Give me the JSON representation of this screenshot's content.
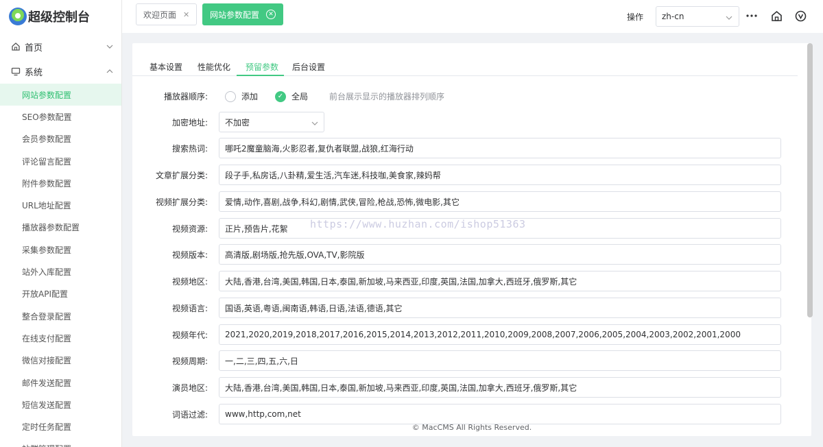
{
  "app": {
    "title": "超级控制台"
  },
  "sidebar": {
    "home": {
      "label": "首页"
    },
    "system": {
      "label": "系统"
    },
    "items": [
      {
        "label": "网站参数配置",
        "active": true
      },
      {
        "label": "SEO参数配置"
      },
      {
        "label": "会员参数配置"
      },
      {
        "label": "评论留言配置"
      },
      {
        "label": "附件参数配置"
      },
      {
        "label": "URL地址配置"
      },
      {
        "label": "播放器参数配置"
      },
      {
        "label": "采集参数配置"
      },
      {
        "label": "站外入库配置"
      },
      {
        "label": "开放API配置"
      },
      {
        "label": "整合登录配置"
      },
      {
        "label": "在线支付配置"
      },
      {
        "label": "微信对接配置"
      },
      {
        "label": "邮件发送配置"
      },
      {
        "label": "短信发送配置"
      },
      {
        "label": "定时任务配置"
      },
      {
        "label": "站群管理配置"
      }
    ]
  },
  "topbar": {
    "tabs": [
      {
        "label": "欢迎页面"
      },
      {
        "label": "网站参数配置",
        "active": true
      }
    ],
    "operation_label": "操作",
    "language": "zh-cn"
  },
  "panel": {
    "tabs": [
      {
        "label": "基本设置"
      },
      {
        "label": "性能优化"
      },
      {
        "label": "预留参数",
        "active": true
      },
      {
        "label": "后台设置"
      }
    ],
    "player_order": {
      "label": "播放器顺序:",
      "options": [
        "添加",
        "全局"
      ],
      "selected": "全局",
      "hint": "前台展示显示的播放器排列顺序"
    },
    "encrypt": {
      "label": "加密地址:",
      "value": "不加密"
    },
    "fields": [
      {
        "label": "搜索热词:",
        "value": "哪吒2魔童脑海,火影忍者,复仇者联盟,战狼,红海行动"
      },
      {
        "label": "文章扩展分类:",
        "value": "段子手,私房话,八卦精,爱生活,汽车迷,科技咖,美食家,辣妈帮"
      },
      {
        "label": "视频扩展分类:",
        "value": "爱情,动作,喜剧,战争,科幻,剧情,武侠,冒险,枪战,恐怖,微电影,其它"
      },
      {
        "label": "视频资源:",
        "value": "正片,预告片,花絮"
      },
      {
        "label": "视频版本:",
        "value": "高清版,剧场版,抢先版,OVA,TV,影院版"
      },
      {
        "label": "视频地区:",
        "value": "大陆,香港,台湾,美国,韩国,日本,泰国,新加坡,马来西亚,印度,英国,法国,加拿大,西班牙,俄罗斯,其它"
      },
      {
        "label": "视频语言:",
        "value": "国语,英语,粤语,闽南语,韩语,日语,法语,德语,其它"
      },
      {
        "label": "视频年代:",
        "value": "2021,2020,2019,2018,2017,2016,2015,2014,2013,2012,2011,2010,2009,2008,2007,2006,2005,2004,2003,2002,2001,2000"
      },
      {
        "label": "视频周期:",
        "value": "一,二,三,四,五,六,日"
      },
      {
        "label": "演员地区:",
        "value": "大陆,香港,台湾,美国,韩国,日本,泰国,新加坡,马来西亚,印度,英国,法国,加拿大,西班牙,俄罗斯,其它"
      },
      {
        "label": "词语过滤:",
        "value": "www,http,com,net"
      }
    ],
    "watermark": "https://www.huzhan.com/ishop51363",
    "footer": "© MacCMS All Rights Reserved."
  },
  "colors": {
    "accent": "#42c983",
    "active_bg": "#e6f7ee"
  }
}
